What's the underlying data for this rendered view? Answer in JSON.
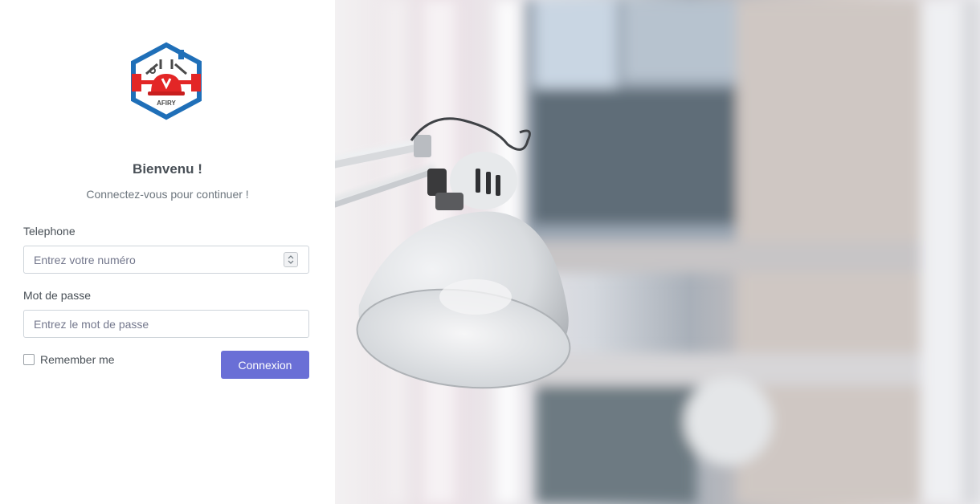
{
  "brand": {
    "logo_text": "AFIRY"
  },
  "login": {
    "title": "Bienvenu !",
    "subtitle": "Connectez-vous pour continuer !",
    "phone_label": "Telephone",
    "phone_placeholder": "Entrez votre numéro",
    "password_label": "Mot de passe",
    "password_placeholder": "Entrez le mot de passe",
    "remember_label": "Remember me",
    "remember_checked": false,
    "submit_label": "Connexion"
  },
  "theme": {
    "primary_button": "#6a6fd6",
    "logo_blue": "#1f6fb8",
    "logo_red": "#e32626"
  },
  "hero_image": {
    "subject": "desk-lamp-photo"
  }
}
